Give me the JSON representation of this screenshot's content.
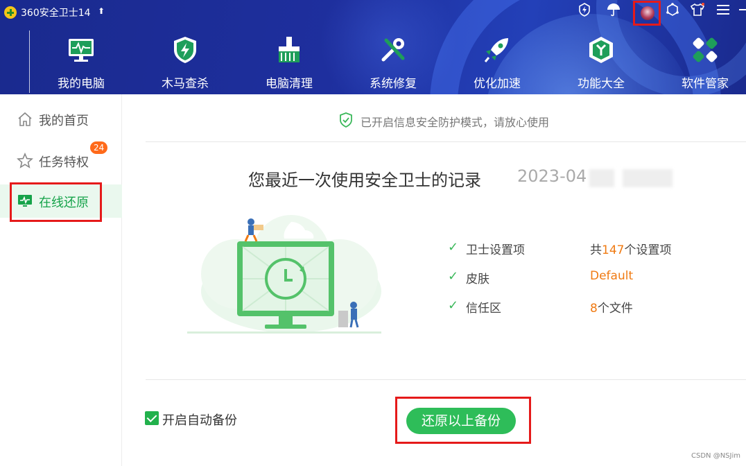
{
  "app": {
    "title": "360安全卫士14",
    "update_icon": "arrow-up-icon"
  },
  "top_icons": [
    "shield-badge-icon",
    "umbrella-icon",
    "avatar",
    "hexagon-icon",
    "shirt-icon",
    "menu-icon"
  ],
  "nav": [
    {
      "label": "我的电脑",
      "icon": "monitor-icon"
    },
    {
      "label": "木马查杀",
      "icon": "shield-bolt-icon"
    },
    {
      "label": "电脑清理",
      "icon": "broom-icon"
    },
    {
      "label": "系统修复",
      "icon": "tools-icon"
    },
    {
      "label": "优化加速",
      "icon": "rocket-icon"
    },
    {
      "label": "功能大全",
      "icon": "cube-icon"
    },
    {
      "label": "软件管家",
      "icon": "apps-icon"
    }
  ],
  "sidebar": {
    "items": [
      {
        "label": "我的首页",
        "icon": "home-icon"
      },
      {
        "label": "任务特权",
        "icon": "star-icon",
        "badge": "24"
      },
      {
        "label": "在线还原",
        "icon": "restore-monitor-icon",
        "active": true
      }
    ]
  },
  "notice": {
    "text": "已开启信息安全防护模式，请放心使用",
    "icon": "shield-check-icon"
  },
  "record": {
    "title": "您最近一次使用安全卫士的记录",
    "date": "2023-04"
  },
  "info": [
    {
      "key": "卫士设置项",
      "prefix": "共",
      "value": "147",
      "suffix": "个设置项"
    },
    {
      "key": "皮肤",
      "prefix": "",
      "value": "Default",
      "suffix": ""
    },
    {
      "key": "信任区",
      "prefix": "",
      "value": "8",
      "suffix": "个文件"
    }
  ],
  "auto_backup": {
    "label": "开启自动备份",
    "checked": true
  },
  "restore_button": {
    "label": "还原以上备份"
  },
  "watermark": "CSDN @NSJim",
  "colors": {
    "header": "#1e2f9e",
    "accent_green": "#2ebd59",
    "orange": "#f07a12",
    "highlight_red": "#e51a1a"
  }
}
